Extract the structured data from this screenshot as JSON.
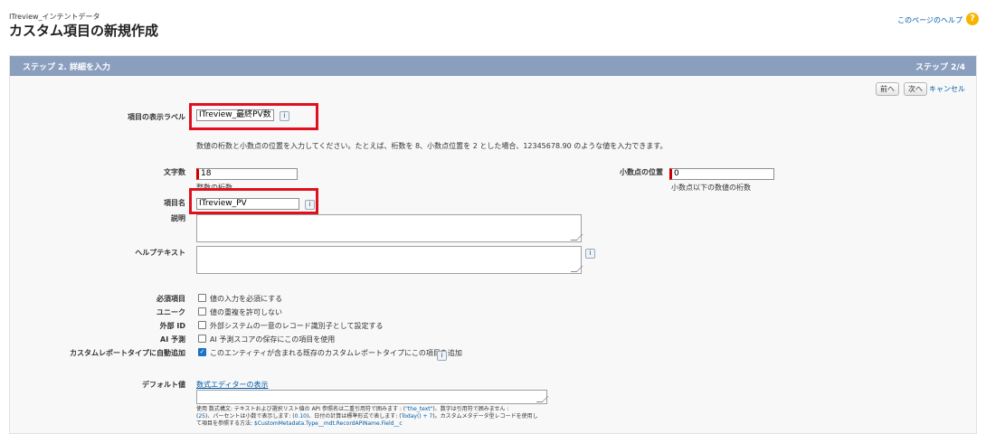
{
  "header": {
    "breadcrumb": "ITreview_インテントデータ",
    "title": "カスタム項目の新規作成",
    "help_link": "このページのヘルプ",
    "help_icon": "help-icon"
  },
  "step": {
    "left": "ステップ 2. 詳細を入力",
    "right": "ステップ 2/4"
  },
  "buttons": {
    "prev": "前へ",
    "next": "次へ",
    "cancel": "キャンセル"
  },
  "form": {
    "label_field_label": "項目の表示ラベル",
    "label_field_value": "ITreview_最終PV数",
    "instruction": "数値の桁数と小数点の位置を入力してください。たとえば、桁数を 8、小数点位置を 2 とした場合、12345678.90 のような値を入力できます。",
    "length_label": "文字数",
    "length_value": "18",
    "length_hint": "整数の桁数",
    "decimal_label": "小数点の位置",
    "decimal_value": "0",
    "decimal_hint": "小数点以下の数値の桁数",
    "field_name_label": "項目名",
    "field_name_value": "ITreview_PV",
    "description_label": "説明",
    "help_text_label": "ヘルプテキスト",
    "required_label": "必須項目",
    "required_text": "値の入力を必須にする",
    "unique_label": "ユニーク",
    "unique_text": "値の重複を許可しない",
    "external_label": "外部 ID",
    "external_text": "外部システムの一意のレコード識別子として設定する",
    "ai_label": "AI 予測",
    "ai_text": "AI 予測スコアの保存にこの項目を使用",
    "report_label": "カスタムレポートタイプに自動追加",
    "report_text": "このエンティティが含まれる既存のカスタムレポートタイプにこの項目を追加",
    "default_label": "デフォルト値",
    "formula_link": "数式エディターの表示",
    "note_line1": "使用 数式構文: テキストおよび選択リスト値の API 参照名は二重引用符で囲みます : (",
    "note_blue1": "\"the_text\"",
    "note_line1b": ")、数字は引用符で囲みません :",
    "note_line2a": "(",
    "note_blue2": "25",
    "note_line2b": ")、パーセントは小数で表示します: (",
    "note_blue3": "0.10",
    "note_line2c": ")、日付の計算は標準形式で表します: (",
    "note_blue4": "Today() + 7",
    "note_line2d": ")。カスタムメタデータ型レコードを使用し",
    "note_line3a": "て項目を参照する方法: ",
    "note_blue5": "$CustomMetadata.Type__mdt.RecordAPIName.Field__c"
  },
  "colors": {
    "step_bar": "#8a9ebe",
    "highlight": "#e0101e",
    "link": "#015ba7"
  }
}
